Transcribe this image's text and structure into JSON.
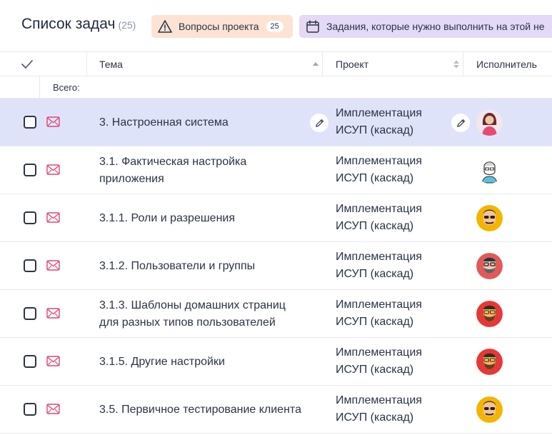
{
  "header": {
    "title": "Список задач",
    "count": "(25)",
    "issues_chip": {
      "label": "Вопросы проекта",
      "count": "25",
      "icon": "warning-icon",
      "color": "#fde3d4"
    },
    "tasks_chip": {
      "label": "Задания, которые нужно выполнить на этой не",
      "icon": "calendar-icon",
      "color": "#e4d9f6"
    }
  },
  "columns": {
    "subject": "Тема",
    "project": "Проект",
    "assignee": "Исполнитель"
  },
  "total_label": "Всего:",
  "colors": {
    "selected_row": "#dfe3fa",
    "mail_icon": "#e0466f",
    "border": "#e6e9ef"
  },
  "rows": [
    {
      "subject": "3. Настроенная система",
      "project_line1": "Имплементация",
      "project_line2": "ИСУП (каскад)",
      "avatar": "woman-avatar",
      "selected": true
    },
    {
      "subject": "3.1. Фактическая настройка приложения",
      "project_line1": "Имплементация",
      "project_line2": "ИСУП (каскад)",
      "avatar": "sketch-man-avatar",
      "selected": false
    },
    {
      "subject": "3.1.1. Роли и разрешения",
      "project_line1": "Имплементация",
      "project_line2": "ИСУП (каскад)",
      "avatar": "sunglasses-man-avatar",
      "selected": false
    },
    {
      "subject": "3.1.2. Пользователи и группы",
      "project_line1": "Имплементация",
      "project_line2": "ИСУП (каскад)",
      "avatar": "bearded-man-avatar",
      "selected": false
    },
    {
      "subject": "3.1.3. Шаблоны домашних страниц для разных типов пользователей",
      "project_line1": "Имплементация",
      "project_line2": "ИСУП (каскад)",
      "avatar": "red-bearded-man-avatar",
      "selected": false
    },
    {
      "subject": "3.1.5. Другие настройки",
      "project_line1": "Имплементация",
      "project_line2": "ИСУП (каскад)",
      "avatar": "red-bearded-man-avatar",
      "selected": false
    },
    {
      "subject": "3.5. Первичное тестирование клиента",
      "project_line1": "Имплементация",
      "project_line2": "ИСУП (каскад)",
      "avatar": "sunglasses-man-avatar",
      "selected": false
    }
  ]
}
